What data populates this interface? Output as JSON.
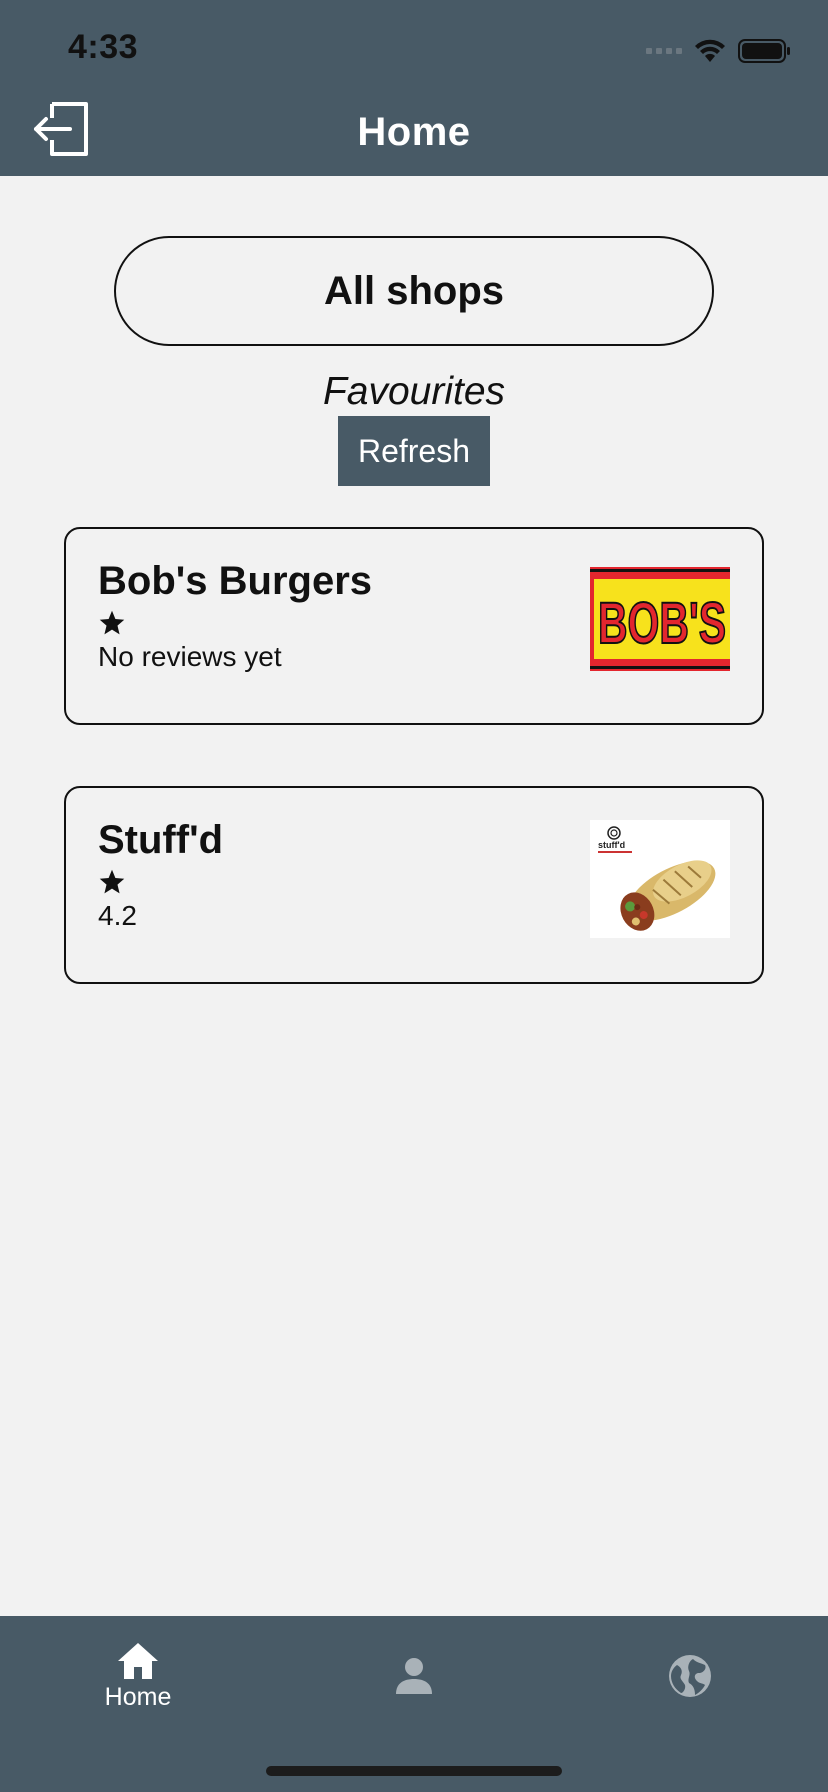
{
  "status_bar": {
    "time": "4:33"
  },
  "header": {
    "title": "Home"
  },
  "main": {
    "all_shops_label": "All shops",
    "section_title": "Favourites",
    "refresh_label": "Refresh"
  },
  "shops": [
    {
      "name": "Bob's Burgers",
      "rating_text": "No reviews yet",
      "logo_text": "BOB'S"
    },
    {
      "name": "Stuff'd",
      "rating_text": "4.2",
      "logo_text": "stuff'd"
    }
  ],
  "tabs": [
    {
      "label": "Home",
      "icon": "home-icon",
      "active": true
    },
    {
      "label": "",
      "icon": "profile-icon",
      "active": false
    },
    {
      "label": "",
      "icon": "globe-icon",
      "active": false
    }
  ],
  "colors": {
    "header_bg": "#485a66",
    "page_bg": "#f2f2f2",
    "inactive_tab": "#a9b2b8"
  }
}
